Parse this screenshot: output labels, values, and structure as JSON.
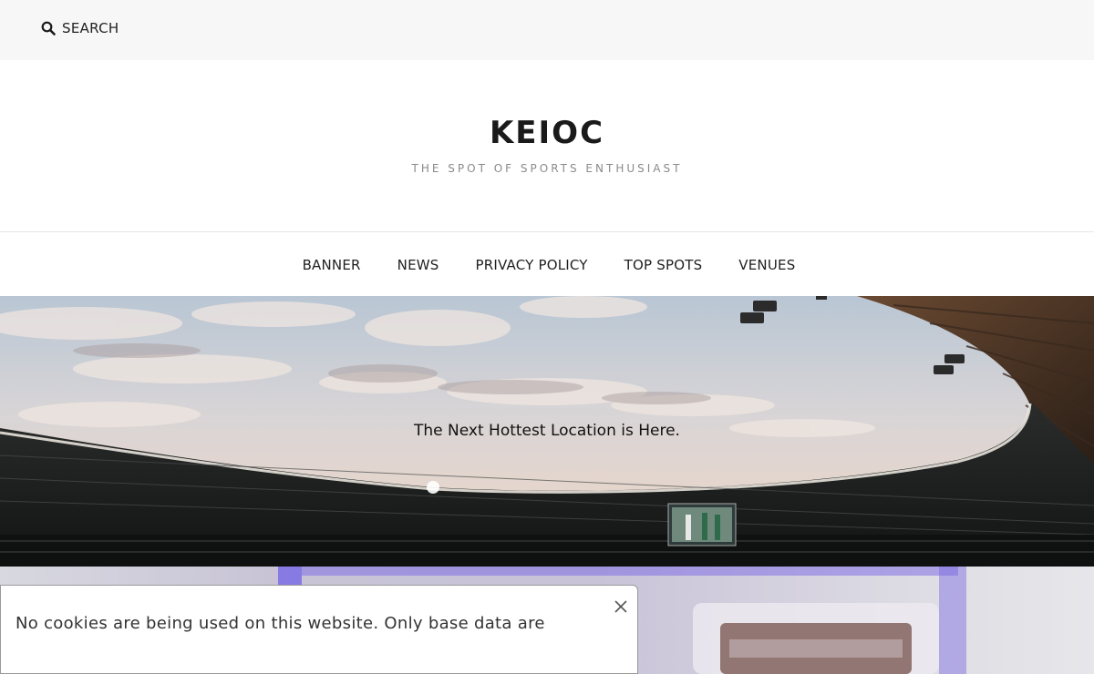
{
  "topbar": {
    "search_label": "SEARCH",
    "search_icon": "search-icon"
  },
  "branding": {
    "title": "KEIOC",
    "description": "THE SPOT OF SPORTS ENTHUSIAST"
  },
  "nav": {
    "items": [
      {
        "label": "BANNER"
      },
      {
        "label": "NEWS"
      },
      {
        "label": "PRIVACY POLICY"
      },
      {
        "label": "TOP SPOTS"
      },
      {
        "label": "VENUES"
      }
    ]
  },
  "hero": {
    "caption": "The Next Hottest Location is Here."
  },
  "cookie": {
    "text": "No cookies are being used on this website. Only base data are",
    "close_icon": "close-icon"
  },
  "colors": {
    "topbar_bg": "#f7f7f7",
    "text": "#1c1c1c",
    "muted": "#8a8a8a"
  }
}
